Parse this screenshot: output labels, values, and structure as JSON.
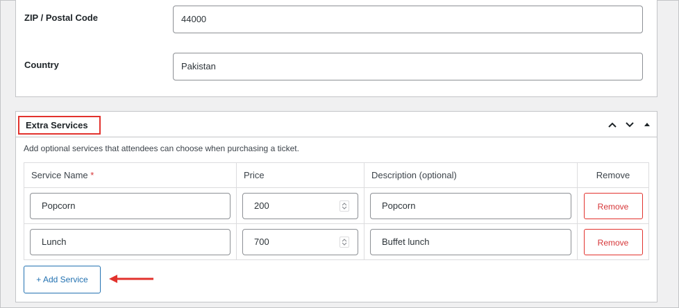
{
  "address": {
    "zip_label": "ZIP / Postal Code",
    "zip_value": "44000",
    "country_label": "Country",
    "country_value": "Pakistan"
  },
  "extra_services": {
    "title": "Extra Services",
    "description": "Add optional services that attendees can choose when purchasing a ticket.",
    "columns": {
      "name": "Service Name",
      "required_mark": "*",
      "price": "Price",
      "description": "Description (optional)",
      "remove": "Remove"
    },
    "rows": [
      {
        "name": "Popcorn",
        "price": "200",
        "description": "Popcorn",
        "remove_label": "Remove"
      },
      {
        "name": "Lunch",
        "price": "700",
        "description": "Buffet lunch",
        "remove_label": "Remove"
      }
    ],
    "add_button_label": "+ Add Service",
    "controls": {
      "move_up_icon": "chevron-up-icon",
      "move_down_icon": "chevron-down-icon",
      "toggle_icon": "caret-up-icon"
    }
  },
  "colors": {
    "highlight_red": "#e2322d",
    "link_blue": "#2271b1",
    "remove_red": "#d63638",
    "background": "#f0f0f1"
  }
}
